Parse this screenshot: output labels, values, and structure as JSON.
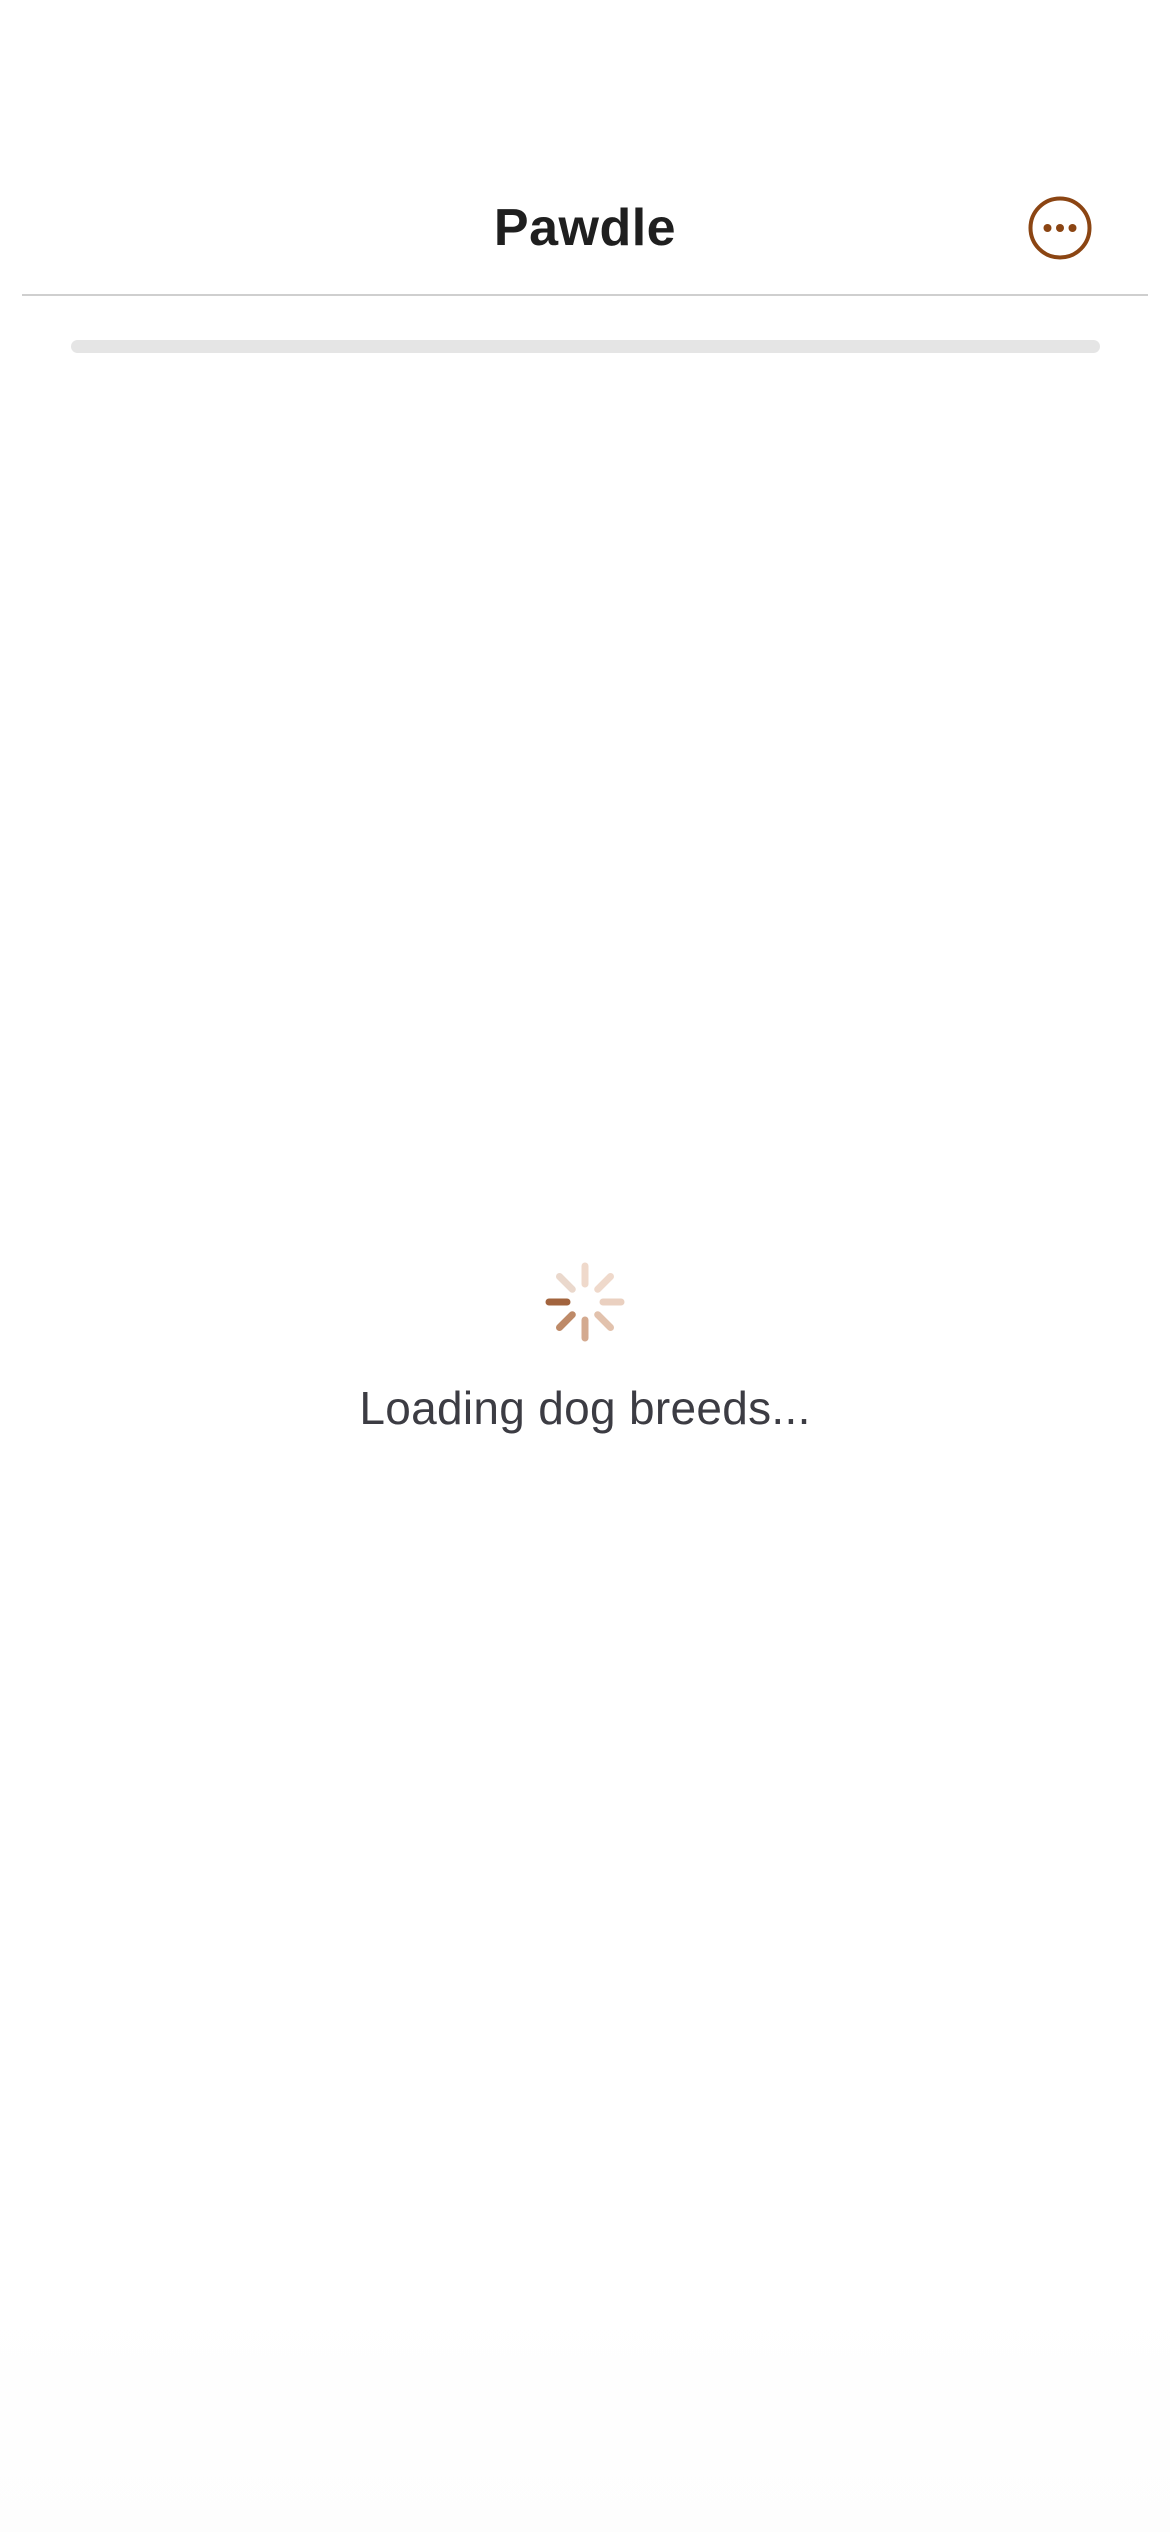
{
  "header": {
    "title": "Pawdle",
    "more_icon": "ellipsis-circle-icon"
  },
  "progress": {
    "value": 0
  },
  "loading": {
    "spinner_icon": "activity-spinner-icon",
    "text": "Loading dog breeds..."
  },
  "colors": {
    "accent": "#8b4513",
    "title": "#1f1f1f",
    "text": "#3c3c43",
    "divider": "#cfcfcf",
    "track": "#e5e5e5"
  }
}
